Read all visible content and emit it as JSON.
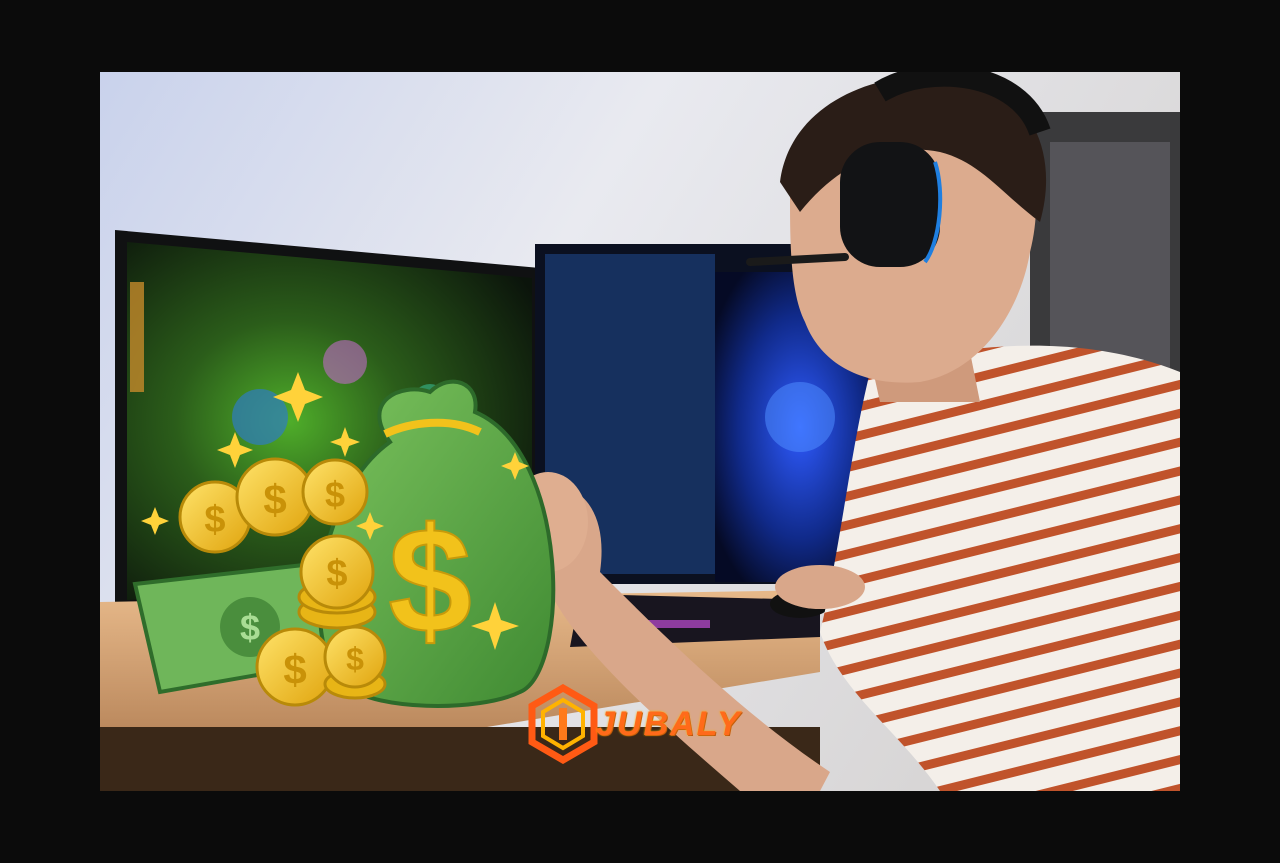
{
  "image": {
    "description_icons": [
      "money-bag-icon",
      "gold-coin-icon",
      "banknote-icon",
      "sparkle-icon"
    ],
    "colors": {
      "background": "#0b0b0b",
      "money_green": "#5fa84a",
      "coin_gold": "#f2c21b",
      "logo_orange": "#ff6a1a",
      "shirt_stripe": "#c0532b"
    }
  },
  "logo": {
    "text": "JUBALY"
  }
}
